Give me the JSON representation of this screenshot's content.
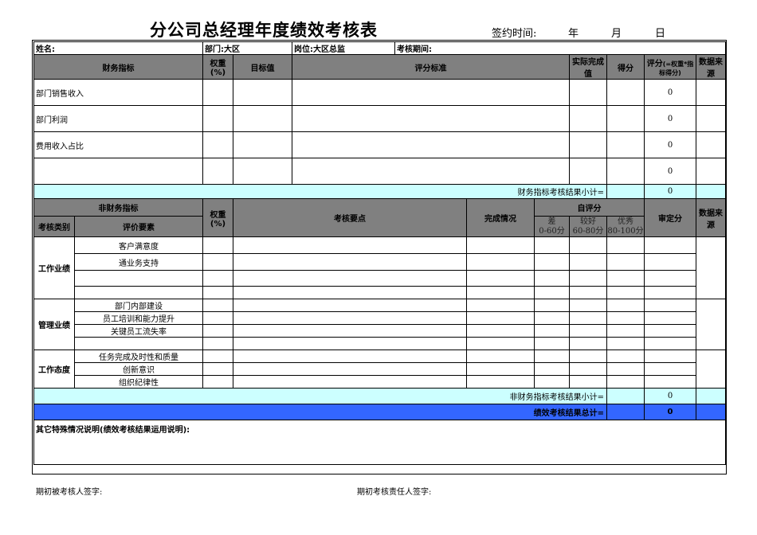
{
  "title": "分公司总经理年度绩效考核表",
  "sign_time": {
    "label": "签约时间:",
    "year": "年",
    "month": "月",
    "day": "日"
  },
  "info": {
    "name": "姓名:",
    "dept": "部门:大区",
    "position": "岗位:大区总监",
    "period": "考核期间:"
  },
  "financial": {
    "headers": {
      "indicator": "财务指标",
      "weight": "权重(%)",
      "target": "目标值",
      "criteria": "评分标准",
      "actual": "实际完成值",
      "score": "得分",
      "rating_main": "评分",
      "rating_note": "(=权重*指标得分)",
      "source": "数据来源"
    },
    "rows": [
      {
        "name": "部门销售收入",
        "rating": "0"
      },
      {
        "name": "部门利润",
        "rating": "0"
      },
      {
        "name": "费用收入占比",
        "rating": "0"
      },
      {
        "name": "",
        "rating": "0"
      }
    ],
    "subtotal_label": "财务指标考核结果小计=",
    "subtotal_value": "0"
  },
  "nonfinancial": {
    "headers": {
      "indicator": "非财务指标",
      "weight": "权重(%)",
      "key_points": "考核要点",
      "completion": "完成情况",
      "self_eval": "自评分",
      "final_score": "审定分",
      "source": "数据来源",
      "category": "考核类别",
      "element": "评价要素",
      "poor": "差",
      "poor_range": "0-60分",
      "good": "较好",
      "good_range": "60-80分",
      "excellent": "优秀",
      "excellent_range": "80-100分"
    },
    "groups": [
      {
        "category": "工作业绩",
        "items": [
          "客户满意度",
          "通业务支持",
          "",
          ""
        ]
      },
      {
        "category": "管理业绩",
        "items": [
          "部门内部建设",
          "员工培训和能力提升",
          "关键员工流失率",
          ""
        ]
      },
      {
        "category": "工作态度",
        "items": [
          "任务完成及时性和质量",
          "创新意识",
          "组织纪律性"
        ]
      }
    ],
    "subtotal_label": "非财务指标考核结果小计=",
    "subtotal_value": "0"
  },
  "total": {
    "label": "绩效考核结果总计=",
    "value": "0"
  },
  "notes_label": "其它特殊情况说明(绩效考核结果运用说明):",
  "signatures": {
    "employee": "期初被考核人签字:",
    "manager": "期初考核责任人签字:"
  }
}
